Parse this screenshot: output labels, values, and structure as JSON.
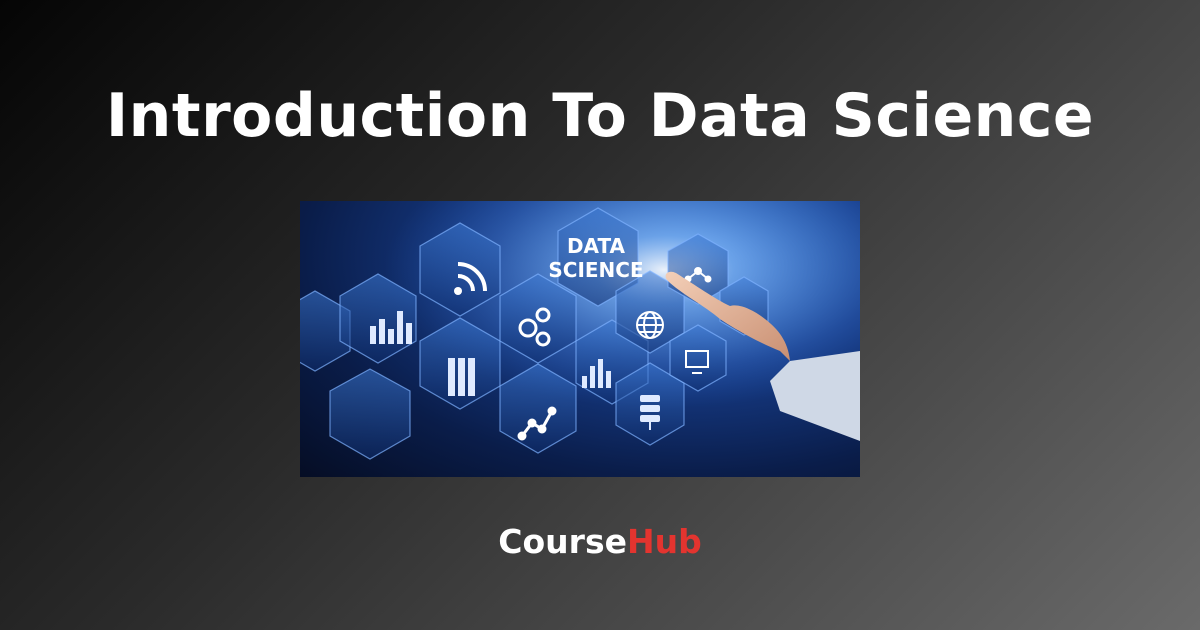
{
  "page": {
    "title": "Introduction To Data Science"
  },
  "hero": {
    "label_line1": "DATA",
    "label_line2": "SCIENCE",
    "icons": [
      "wifi-icon",
      "bar-chart-icon",
      "gears-icon",
      "globe-icon",
      "server-icon",
      "line-chart-icon",
      "database-icon",
      "network-icon",
      "monitor-icon"
    ]
  },
  "brand": {
    "part1": "Course",
    "part2": "Hub",
    "accent_color": "#e3342f"
  }
}
